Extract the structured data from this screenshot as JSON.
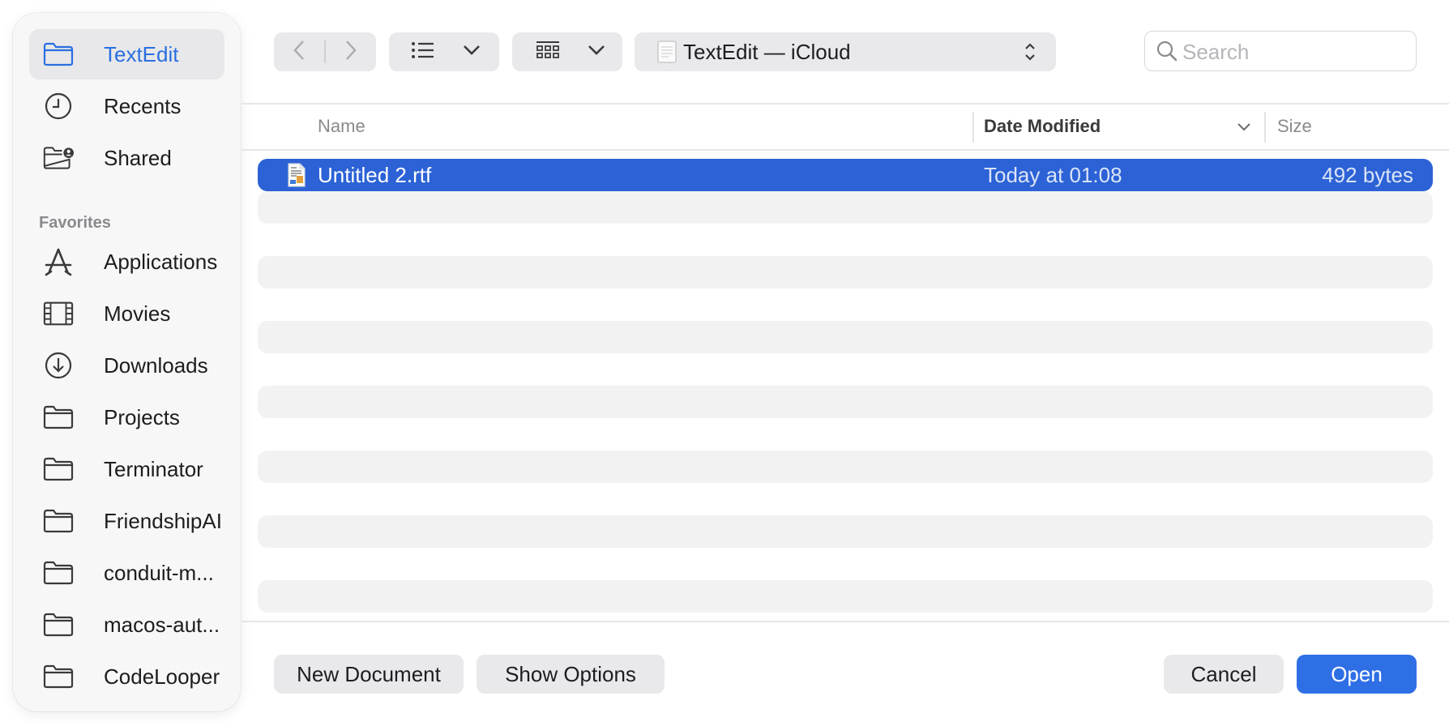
{
  "sidebar": {
    "items": [
      {
        "label": "TextEdit",
        "icon": "folder-icon"
      },
      {
        "label": "Recents",
        "icon": "clock-icon"
      },
      {
        "label": "Shared",
        "icon": "shared-folder-icon"
      }
    ],
    "favorites_heading": "Favorites",
    "favorites": [
      {
        "label": "Applications",
        "icon": "applications-icon"
      },
      {
        "label": "Movies",
        "icon": "film-icon"
      },
      {
        "label": "Downloads",
        "icon": "download-icon"
      },
      {
        "label": "Projects",
        "icon": "folder-icon"
      },
      {
        "label": "Terminator",
        "icon": "folder-icon"
      },
      {
        "label": "FriendshipAI",
        "icon": "folder-icon"
      },
      {
        "label": "conduit-m...",
        "icon": "folder-icon"
      },
      {
        "label": "macos-aut...",
        "icon": "folder-icon"
      },
      {
        "label": "CodeLooper",
        "icon": "folder-icon"
      }
    ]
  },
  "toolbar": {
    "location": "TextEdit — iCloud",
    "search_placeholder": "Search"
  },
  "table": {
    "columns": {
      "name": "Name",
      "date": "Date Modified",
      "size": "Size"
    },
    "rows": [
      {
        "name": "Untitled 2.rtf",
        "date": "Today at 01:08",
        "size": "492 bytes",
        "selected": true
      }
    ]
  },
  "buttons": {
    "new_document": "New Document",
    "show_options": "Show Options",
    "cancel": "Cancel",
    "open": "Open"
  },
  "colors": {
    "accent": "#2f6fe6",
    "selection": "#2c62d6",
    "sidebar_active_text": "#2a6fe0"
  }
}
